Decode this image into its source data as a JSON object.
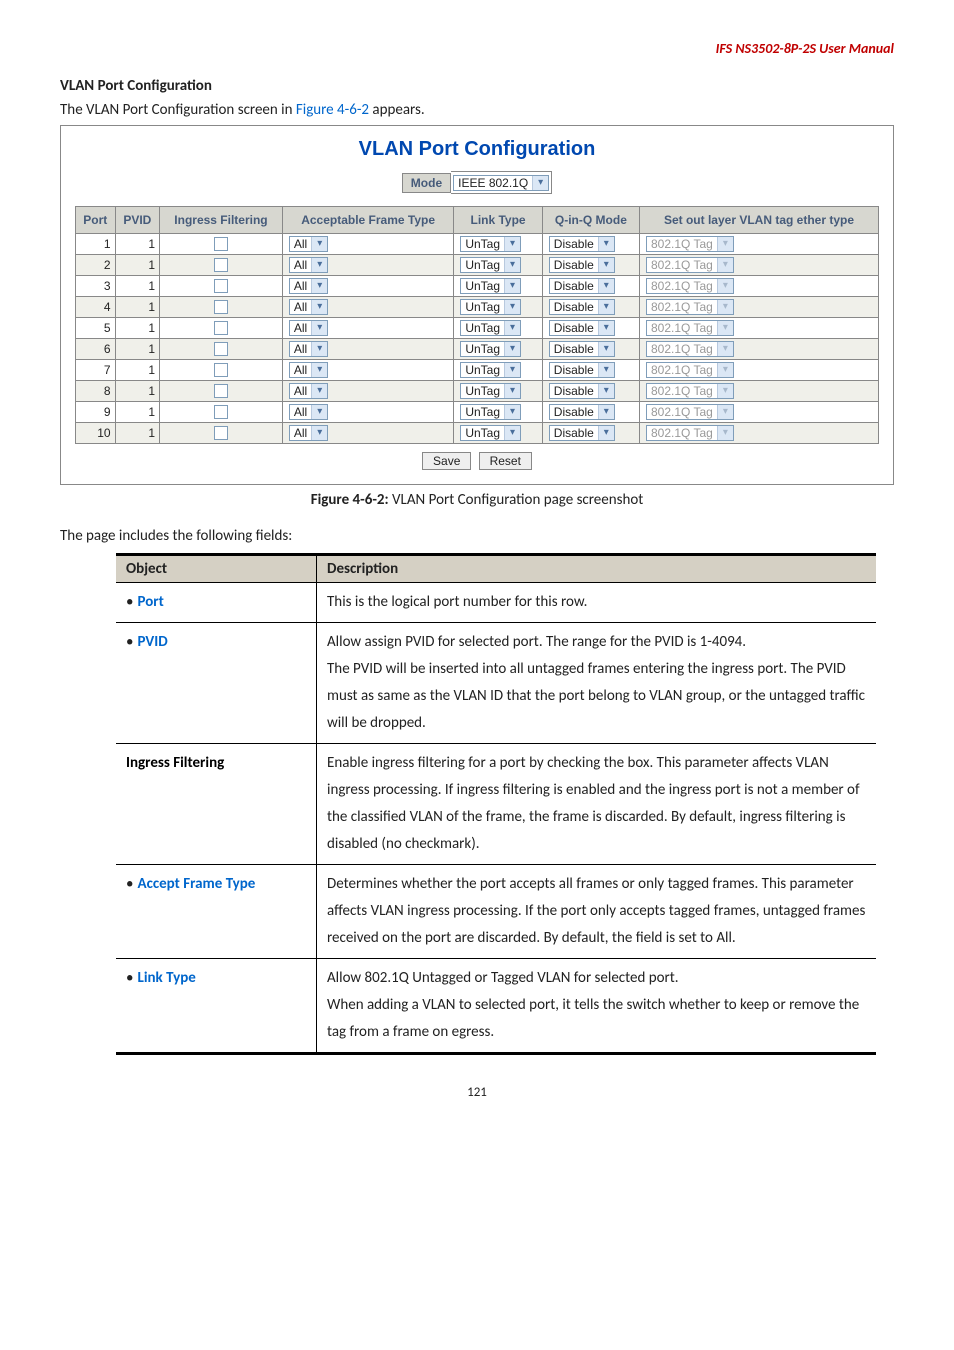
{
  "header": {
    "doc_title": "IFS  NS3502-8P-2S  User Manual"
  },
  "section": {
    "heading": "VLAN Port Configuration",
    "intro_pre": "The VLAN Port Configuration screen in ",
    "intro_link": "Figure 4-6-2",
    "intro_post": " appears."
  },
  "config": {
    "title": "VLAN Port Configuration",
    "mode_label": "Mode",
    "mode_value": "IEEE 802.1Q",
    "columns": {
      "port": "Port",
      "pvid": "PVID",
      "ingress": "Ingress Filtering",
      "accept": "Acceptable Frame Type",
      "link": "Link Type",
      "qinq": "Q-in-Q Mode",
      "tag": "Set out layer VLAN tag ether type"
    },
    "rows": [
      {
        "port": "1",
        "pvid": "1",
        "accept": "All",
        "link": "UnTag",
        "qinq": "Disable",
        "tag": "802.1Q Tag"
      },
      {
        "port": "2",
        "pvid": "1",
        "accept": "All",
        "link": "UnTag",
        "qinq": "Disable",
        "tag": "802.1Q Tag"
      },
      {
        "port": "3",
        "pvid": "1",
        "accept": "All",
        "link": "UnTag",
        "qinq": "Disable",
        "tag": "802.1Q Tag"
      },
      {
        "port": "4",
        "pvid": "1",
        "accept": "All",
        "link": "UnTag",
        "qinq": "Disable",
        "tag": "802.1Q Tag"
      },
      {
        "port": "5",
        "pvid": "1",
        "accept": "All",
        "link": "UnTag",
        "qinq": "Disable",
        "tag": "802.1Q Tag"
      },
      {
        "port": "6",
        "pvid": "1",
        "accept": "All",
        "link": "UnTag",
        "qinq": "Disable",
        "tag": "802.1Q Tag"
      },
      {
        "port": "7",
        "pvid": "1",
        "accept": "All",
        "link": "UnTag",
        "qinq": "Disable",
        "tag": "802.1Q Tag"
      },
      {
        "port": "8",
        "pvid": "1",
        "accept": "All",
        "link": "UnTag",
        "qinq": "Disable",
        "tag": "802.1Q Tag"
      },
      {
        "port": "9",
        "pvid": "1",
        "accept": "All",
        "link": "UnTag",
        "qinq": "Disable",
        "tag": "802.1Q Tag"
      },
      {
        "port": "10",
        "pvid": "1",
        "accept": "All",
        "link": "UnTag",
        "qinq": "Disable",
        "tag": "802.1Q Tag"
      }
    ],
    "buttons": {
      "save": "Save",
      "reset": "Reset"
    }
  },
  "caption": {
    "bold": "Figure 4-6-2:",
    "rest": " VLAN Port Configuration page screenshot"
  },
  "fields_intro": "The page includes the following fields:",
  "desc_table": {
    "head": {
      "object": "Object",
      "description": "Description"
    },
    "rows": [
      {
        "bullet": "•",
        "label": "Port",
        "label_class": "blue",
        "desc": "This is the logical port number for this row."
      },
      {
        "bullet": "•",
        "label": "PVID",
        "label_class": "blue",
        "desc": "Allow assign PVID for selected port. The range for the PVID is 1-4094.\nThe PVID will be inserted into all untagged frames entering the ingress port. The PVID must as same as the VLAN ID that the port belong to VLAN group, or the untagged traffic will be dropped."
      },
      {
        "bullet": "",
        "label": "Ingress Filtering",
        "label_class": "black",
        "desc": "Enable ingress filtering for a port by checking the box. This parameter affects VLAN ingress processing. If ingress filtering is enabled and the ingress port is not a member of the classified VLAN of the frame, the frame is discarded. By default, ingress filtering is disabled (no checkmark)."
      },
      {
        "bullet": "•",
        "label": "Accept Frame Type",
        "label_class": "blue",
        "desc": "Determines whether the port accepts all frames or only tagged frames. This parameter affects VLAN ingress processing. If the port only accepts tagged frames, untagged frames received on the port are discarded. By default, the field is set to All."
      },
      {
        "bullet": "•",
        "label": "Link Type",
        "label_class": "blue",
        "desc": "Allow 802.1Q Untagged or Tagged VLAN for selected port.\nWhen adding a VLAN to selected port, it tells the switch whether to keep or remove the tag from a frame on egress."
      }
    ]
  },
  "page_number": "121"
}
